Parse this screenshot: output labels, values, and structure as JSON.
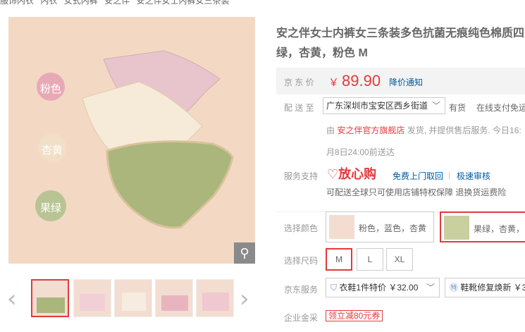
{
  "breadcrumb": [
    "服饰内衣",
    "内衣",
    "女式内裤",
    "安之伴",
    "安之伴女士内裤女三条装"
  ],
  "main_image": {
    "labels": [
      "粉色",
      "杏黄",
      "果绿"
    ],
    "label_colors": [
      "#e8a9b6",
      "#f1dfc8",
      "#b8c493"
    ]
  },
  "zoom_icon": "⚲",
  "thumb_nav": {
    "prev": "‹",
    "next": "›"
  },
  "thumbnails": [
    "thumb-1",
    "thumb-2",
    "thumb-3",
    "thumb-4",
    "thumb-5"
  ],
  "product": {
    "title_line1": "安之伴女士内裤女三条装多色抗菌无痕纯色棉质四",
    "title_line2": "绿，杏黄，粉色 M",
    "price_label": "京 东 价",
    "currency": "￥",
    "price": "89.90",
    "price_notify": "降价通知",
    "ship_label": "配 送 至",
    "address": "广东深圳市宝安区西乡街道",
    "stock": "有货",
    "payment": "在线支付免运",
    "seller_prefix": "由",
    "seller": "安之伴官方旗舰店",
    "seller_suffix": "发货, 并提供售后服务. 今日16:",
    "delivery": "月8日24:00前送达",
    "support_label": "服务支持",
    "safe_logo": "放心购",
    "svc_return": "免费上门取回",
    "svc_sep": "|",
    "svc_review": "极速审核",
    "svc_note": "可配送全球只可使用店铺特权保障 退换货运费险",
    "color_label": "选择颜色",
    "colors": [
      "粉色，蓝色，杏黄",
      "果绿，杏黄，"
    ],
    "size_label": "选择尺码",
    "sizes": [
      "M",
      "L",
      "XL"
    ],
    "service_label": "京东服务",
    "service1": "衣鞋1件特价 ￥32.00",
    "service2": "鞋靴修复焕新 ￥3",
    "enterprise_label": "企业金采",
    "coupon": "领立减80元券"
  }
}
